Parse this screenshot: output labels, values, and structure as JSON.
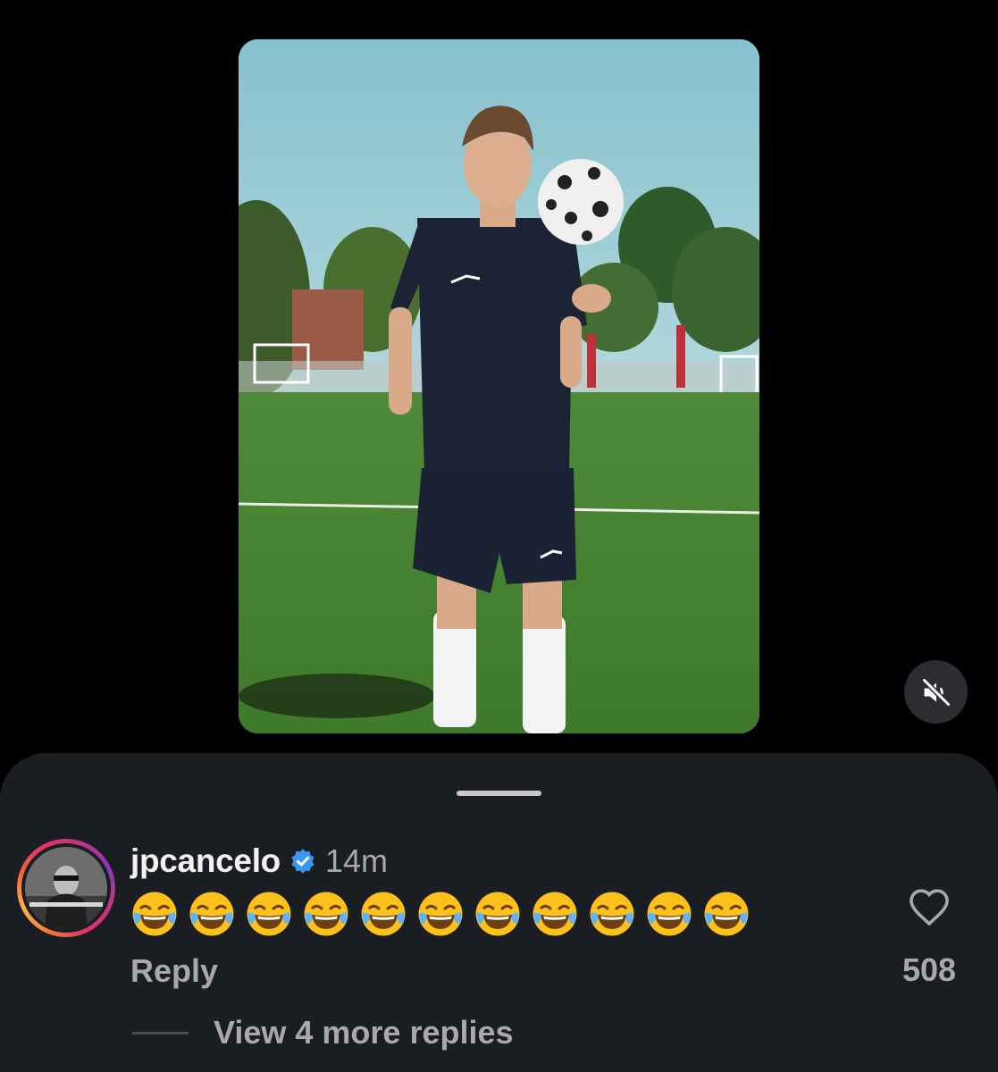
{
  "video": {
    "description_icon": "video-thumbnail",
    "mute_icon": "speaker-muted-icon"
  },
  "comment": {
    "username": "jpcancelo",
    "verified_icon": "verified-badge-icon",
    "time": "14m",
    "text": "😂😂😂😂😂😂😂😂😂😂😂",
    "emoji_count": 11,
    "reply_label": "Reply",
    "like_icon": "heart-icon",
    "like_count": "508",
    "view_more_label": "View 4 more replies"
  },
  "colors": {
    "sheet_bg": "#1a1d22",
    "secondary_text": "#a8a8ad",
    "verified_blue": "#3897f0"
  }
}
